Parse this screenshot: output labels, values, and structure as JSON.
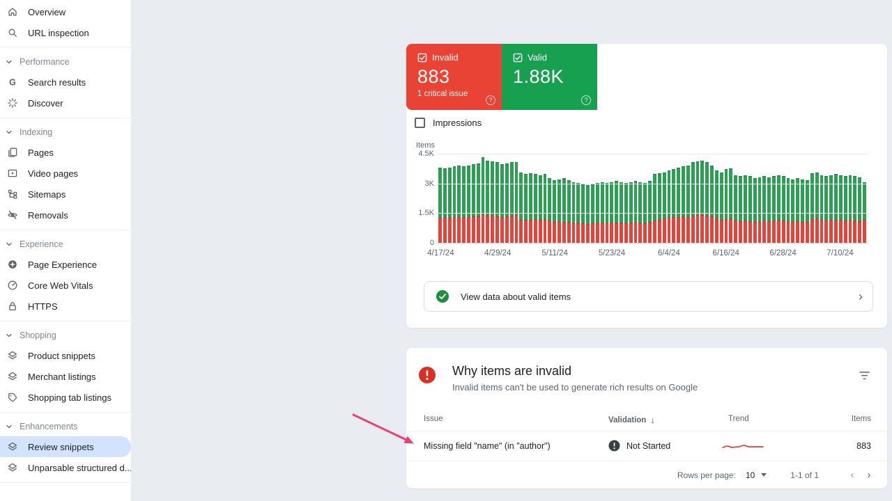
{
  "sidebar": {
    "top_items": [
      {
        "label": "Overview",
        "icon": "home"
      },
      {
        "label": "URL inspection",
        "icon": "search"
      }
    ],
    "sections": [
      {
        "label": "Performance",
        "items": [
          {
            "label": "Search results",
            "icon": "g"
          },
          {
            "label": "Discover",
            "icon": "discover"
          }
        ]
      },
      {
        "label": "Indexing",
        "items": [
          {
            "label": "Pages",
            "icon": "copy"
          },
          {
            "label": "Video pages",
            "icon": "video"
          },
          {
            "label": "Sitemaps",
            "icon": "sitemap"
          },
          {
            "label": "Removals",
            "icon": "eye-off"
          }
        ]
      },
      {
        "label": "Experience",
        "items": [
          {
            "label": "Page Experience",
            "icon": "plus-circle"
          },
          {
            "label": "Core Web Vitals",
            "icon": "speedometer"
          },
          {
            "label": "HTTPS",
            "icon": "lock"
          }
        ]
      },
      {
        "label": "Shopping",
        "items": [
          {
            "label": "Product snippets",
            "icon": "layers"
          },
          {
            "label": "Merchant listings",
            "icon": "layers"
          },
          {
            "label": "Shopping tab listings",
            "icon": "tag"
          }
        ]
      },
      {
        "label": "Enhancements",
        "items": [
          {
            "label": "Review snippets",
            "icon": "layers",
            "selected": true
          },
          {
            "label": "Unparsable structured d...",
            "icon": "layers"
          }
        ]
      }
    ]
  },
  "summary_cards": {
    "invalid": {
      "label": "Invalid",
      "count": "883",
      "sub": "1 critical issue",
      "color": "#e94335"
    },
    "valid": {
      "label": "Valid",
      "count": "1.88K",
      "color": "#17a04f"
    }
  },
  "impressions_label": "Impressions",
  "chart_data": {
    "type": "bar",
    "stacked": true,
    "title": "",
    "ylabel": "Items",
    "ylim": [
      0,
      4.5
    ],
    "yticks": [
      {
        "label": "4.5K",
        "value": 4.5
      },
      {
        "label": "3K",
        "value": 3.0
      },
      {
        "label": "1.5K",
        "value": 1.5
      },
      {
        "label": "0",
        "value": 0
      }
    ],
    "xtick_labels": [
      "4/17/24",
      "4/29/24",
      "5/11/24",
      "5/23/24",
      "6/4/24",
      "6/16/24",
      "6/28/24",
      "7/10/24"
    ],
    "xtick_day_indices": [
      0,
      12,
      24,
      36,
      48,
      60,
      72,
      84
    ],
    "legend": [
      {
        "name": "Invalid",
        "color": "#e1453c"
      },
      {
        "name": "Valid",
        "color": "#2f9e55"
      }
    ],
    "unit": "thousand items per day",
    "totals": [
      3.85,
      3.8,
      3.85,
      3.9,
      3.95,
      3.9,
      3.95,
      4.0,
      4.05,
      4.35,
      4.2,
      4.15,
      4.1,
      4.0,
      4.05,
      4.1,
      4.1,
      3.6,
      3.5,
      3.55,
      3.5,
      3.45,
      3.5,
      3.3,
      3.2,
      3.25,
      3.3,
      3.2,
      3.1,
      3.05,
      3.0,
      2.95,
      3.0,
      3.05,
      3.1,
      3.05,
      3.1,
      3.15,
      3.1,
      3.05,
      3.1,
      3.15,
      3.1,
      3.05,
      3.15,
      3.5,
      3.55,
      3.6,
      3.7,
      3.75,
      3.85,
      3.9,
      3.95,
      4.1,
      4.15,
      4.2,
      4.1,
      3.95,
      3.7,
      3.6,
      3.75,
      3.8,
      3.45,
      3.4,
      3.45,
      3.4,
      3.3,
      3.35,
      3.4,
      3.35,
      3.4,
      3.45,
      3.4,
      3.3,
      3.25,
      3.3,
      3.25,
      3.2,
      3.55,
      3.6,
      3.45,
      3.4,
      3.45,
      3.5,
      3.45,
      3.4,
      3.45,
      3.4,
      3.35,
      3.1
    ],
    "invalid": [
      1.3,
      1.32,
      1.3,
      1.33,
      1.35,
      1.33,
      1.35,
      1.37,
      1.38,
      1.48,
      1.42,
      1.4,
      1.38,
      1.35,
      1.38,
      1.42,
      1.44,
      1.2,
      1.18,
      1.2,
      1.22,
      1.2,
      1.22,
      1.15,
      1.1,
      1.12,
      1.1,
      1.08,
      1.05,
      1.05,
      1.02,
      1.0,
      1.02,
      1.05,
      1.05,
      1.03,
      1.05,
      1.07,
      1.05,
      1.03,
      1.05,
      1.08,
      1.05,
      1.02,
      1.08,
      1.15,
      1.2,
      1.25,
      1.3,
      1.32,
      1.35,
      1.38,
      1.35,
      1.42,
      1.45,
      1.45,
      1.4,
      1.38,
      1.25,
      1.2,
      1.22,
      1.25,
      1.15,
      1.12,
      1.15,
      1.12,
      1.1,
      1.12,
      1.15,
      1.12,
      1.15,
      1.18,
      1.15,
      1.12,
      1.1,
      1.12,
      1.1,
      1.08,
      1.22,
      1.25,
      1.18,
      1.15,
      1.18,
      1.2,
      1.18,
      1.15,
      1.18,
      1.15,
      1.12,
      1.18
    ]
  },
  "valid_items_link": "View data about valid items",
  "invalid_panel": {
    "title": "Why items are invalid",
    "subtitle": "Invalid items can't be used to generate rich results on Google",
    "columns": [
      "Issue",
      "Validation",
      "Trend",
      "Items"
    ],
    "sort_arrow": "↓",
    "rows": [
      {
        "issue": "Missing field \"name\" (in \"author\")",
        "validation": "Not Started",
        "items": "883"
      }
    ],
    "footer": {
      "rows_per_page_label": "Rows per page:",
      "rows_per_page": "10",
      "range": "1-1 of 1",
      "prev": "‹",
      "next": "›"
    }
  },
  "colors": {
    "invalid_red": "#e94335",
    "valid_green": "#17a04f",
    "bar_green": "#2f9e55",
    "bar_red": "#e1453c",
    "selected_nav": "#d3e3fd",
    "annotation_pink": "#e8416f",
    "badge_dark": "#3c4043",
    "error_circle": "#d93025",
    "success_circle": "#1e8e3e"
  }
}
